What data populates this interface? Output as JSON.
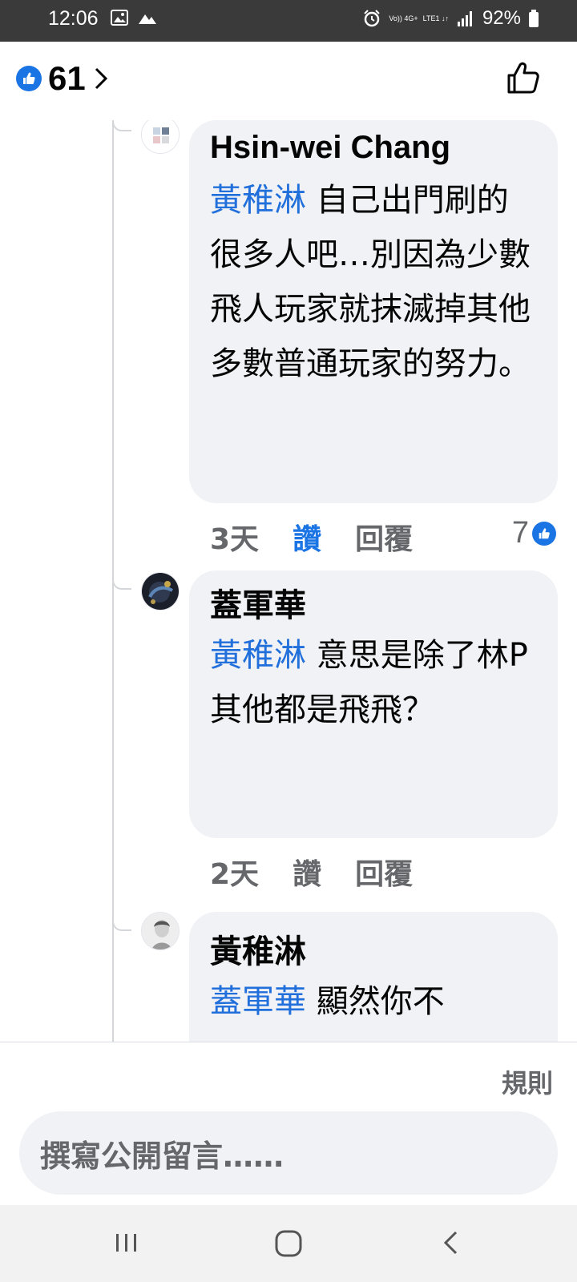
{
  "status_bar": {
    "time": "12:06",
    "network_top": "Vo)) 4G+",
    "network_bottom": "LTE1 ↓↑",
    "battery": "92%"
  },
  "header": {
    "like_count": "61"
  },
  "comments": [
    {
      "author": "Hsin-wei Chang",
      "mention": "黃稚淋",
      "text": " 自己出門刷的很多人吧…別因為少數飛人玩家就抹滅掉其他多數普通玩家的努力。",
      "time": "3天",
      "like_label": "讚",
      "reply_label": "回覆",
      "reaction_count": "7",
      "liked": true
    },
    {
      "author": "蓋軍華",
      "mention": "黃稚淋",
      "text": " 意思是除了林P其他都是飛飛？",
      "time": "2天",
      "like_label": "讚",
      "reply_label": "回覆"
    },
    {
      "author": "黃稚淋",
      "mention": "蓋軍華",
      "text": " 顯然你不"
    }
  ],
  "footer": {
    "rules_label": "規則",
    "compose_placeholder": "撰寫公開留言……"
  },
  "colors": {
    "accent": "#1b74e4",
    "mention": "#216fdb",
    "bubble": "#f0f2f5",
    "muted": "#65676b"
  },
  "icons": {
    "header_reaction": "like-reaction-icon",
    "header_like_button": "thumbs-up-outline-icon",
    "nav": [
      "recent-apps-icon",
      "home-icon",
      "back-icon"
    ]
  }
}
